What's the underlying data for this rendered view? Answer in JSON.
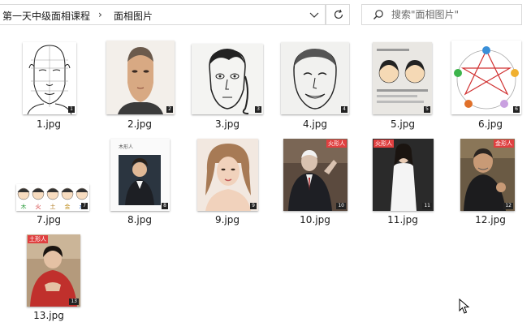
{
  "address": {
    "crumbs": [
      "第一天中级面相课程",
      "面相图片"
    ],
    "separator": "›"
  },
  "search": {
    "placeholder": "搜索\"面相图片\""
  },
  "files": [
    {
      "name": "1.jpg",
      "badge": "1"
    },
    {
      "name": "2.jpg",
      "badge": "2"
    },
    {
      "name": "3.jpg",
      "badge": "3"
    },
    {
      "name": "4.jpg",
      "badge": "4"
    },
    {
      "name": "5.jpg",
      "badge": "5"
    },
    {
      "name": "6.jpg",
      "badge": "6"
    },
    {
      "name": "7.jpg",
      "badge": "7",
      "elements": [
        "木",
        "火",
        "土",
        "金",
        "水"
      ]
    },
    {
      "name": "8.jpg",
      "badge": "8",
      "caption": "木形人"
    },
    {
      "name": "9.jpg",
      "badge": "9"
    },
    {
      "name": "10.jpg",
      "badge": "10",
      "tag": "火形人"
    },
    {
      "name": "11.jpg",
      "badge": "11",
      "tag": "火形人"
    },
    {
      "name": "12.jpg",
      "badge": "12",
      "tag": "金形人"
    },
    {
      "name": "13.jpg",
      "badge": "13",
      "tag": "土形人"
    }
  ]
}
